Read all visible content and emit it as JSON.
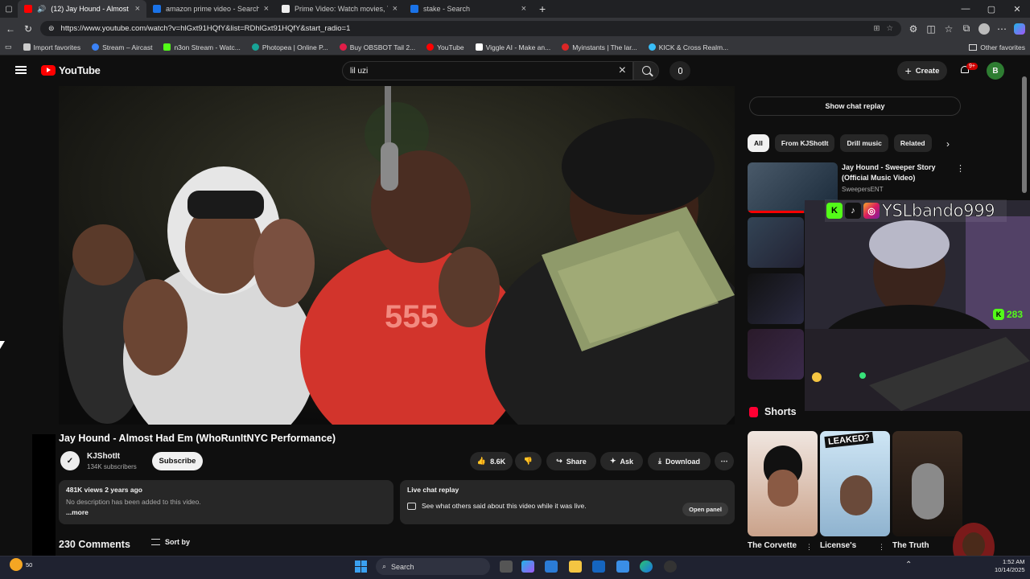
{
  "browser": {
    "tabs": [
      {
        "label": "(12) Jay Hound - Almost Had",
        "color": "#ff0000",
        "active": true
      },
      {
        "label": "amazon prime video - Search",
        "color": "#1a73e8",
        "active": false
      },
      {
        "label": "Prime Video: Watch movies, TV sh",
        "color": "#eeeeee",
        "active": false
      },
      {
        "label": "stake - Search",
        "color": "#1a73e8",
        "active": false
      }
    ],
    "new_tab": "+",
    "url": "https://www.youtube.com/watch?v=hlGxt91HQfY&list=RDhlGxt91HQfY&start_radio=1",
    "bookmarks": [
      {
        "label": "Import favorites",
        "color": "#cccccc"
      },
      {
        "label": "Stream – Aircast",
        "color": "#3b82f6"
      },
      {
        "label": "n3on Stream - Watc...",
        "color": "#53fc18"
      },
      {
        "label": "Photopea | Online P...",
        "color": "#18a497"
      },
      {
        "label": "Buy OBSBOT Tail 2...",
        "color": "#e11d48"
      },
      {
        "label": "YouTube",
        "color": "#ff0000"
      },
      {
        "label": "Viggle AI - Make an...",
        "color": "#ffffff"
      },
      {
        "label": "Myinstants | The lar...",
        "color": "#dc2626"
      },
      {
        "label": "KICK & Cross Realm...",
        "color": "#38bdf8"
      }
    ],
    "other_favorites": "Other favorites"
  },
  "youtube": {
    "logo_text": "YouTube",
    "search_value": "lil uzi",
    "create_label": "Create",
    "notif_badge": "9+",
    "avatar_letter": "B"
  },
  "video": {
    "title": "Jay Hound - Almost Had Em (WhoRunItNYC Performance)",
    "channel": "KJShotIt",
    "subscribers": "134K subscribers",
    "subscribe_label": "Subscribe",
    "likes": "8.6K",
    "share_label": "Share",
    "ask_label": "Ask",
    "download_label": "Download",
    "stats": "481K views  2 years ago",
    "no_description": "No description has been added to this video.",
    "more_label": "...more",
    "live_title": "Live chat replay",
    "live_text": "See what others said about this video while it was live.",
    "open_panel": "Open panel",
    "comments_count": "230 Comments",
    "sort_by": "Sort by"
  },
  "sidebar": {
    "show_chat": "Show chat replay",
    "chips": [
      "All",
      "From KJShotIt",
      "Drill music",
      "Related"
    ],
    "rec_title": "Jay Hound - Sweeper Story (Official Music Video)",
    "rec_channel": "SweepersENT",
    "shorts_label": "Shorts",
    "shorts": [
      "The Corvette",
      "License's",
      "The Truth"
    ]
  },
  "overlay": {
    "handle": "YSLbando999",
    "count": "283"
  },
  "taskbar": {
    "search": "Search",
    "time": "1:52 AM",
    "date": "10/14/2025",
    "weather": "50"
  }
}
